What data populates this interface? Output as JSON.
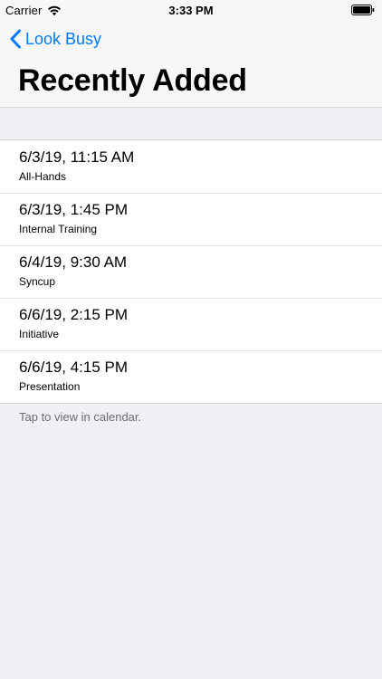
{
  "status_bar": {
    "carrier": "Carrier",
    "time": "3:33 PM",
    "icons": [
      "wifi-icon",
      "battery-icon"
    ]
  },
  "nav": {
    "back_label": "Look Busy",
    "title": "Recently Added"
  },
  "events": [
    {
      "datetime": "6/3/19, 11:15 AM",
      "name": "All-Hands"
    },
    {
      "datetime": "6/3/19, 1:45 PM",
      "name": "Internal Training"
    },
    {
      "datetime": "6/4/19, 9:30 AM",
      "name": "Syncup"
    },
    {
      "datetime": "6/6/19, 2:15 PM",
      "name": "Initiative"
    },
    {
      "datetime": "6/6/19, 4:15 PM",
      "name": "Presentation"
    }
  ],
  "footer": {
    "text": "Tap to view in calendar."
  },
  "colors": {
    "accent": "#007aff",
    "background": "#efeff4",
    "bar_background": "#f7f7f7",
    "footer_text": "#6d6d72"
  }
}
